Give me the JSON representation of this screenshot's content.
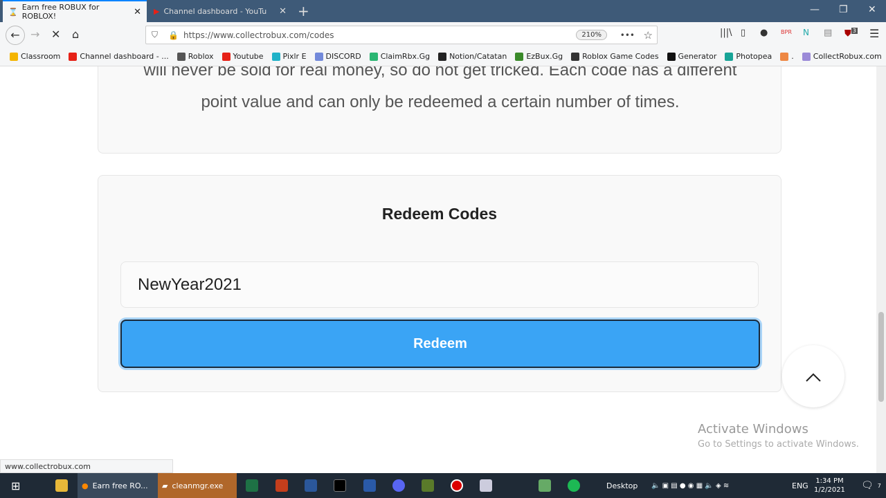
{
  "browser": {
    "tabs": [
      {
        "label": "Earn free ROBUX for ROBLOX!",
        "icon": "hourglass-icon",
        "active": true
      },
      {
        "label": "Channel dashboard - YouTube",
        "icon": "youtube-icon",
        "active": false
      }
    ],
    "url": "https://www.collectrobux.com/codes",
    "zoom": "210%",
    "bookmarks": [
      {
        "label": "Classroom",
        "color": "#f4b400"
      },
      {
        "label": "Channel dashboard - ...",
        "color": "#e62117"
      },
      {
        "label": "Roblox",
        "color": "#555"
      },
      {
        "label": "Youtube",
        "color": "#e62117"
      },
      {
        "label": "Pixlr E",
        "color": "#20b2c8"
      },
      {
        "label": "DISCORD",
        "color": "#7289da"
      },
      {
        "label": "ClaimRbx.Gg",
        "color": "#2bb673"
      },
      {
        "label": "Notion/Catatan",
        "color": "#222"
      },
      {
        "label": "EzBux.Gg",
        "color": "#3a8a2a"
      },
      {
        "label": "Roblox Game Codes",
        "color": "#333"
      },
      {
        "label": "Generator",
        "color": "#111"
      },
      {
        "label": "Photopea",
        "color": "#18a497"
      },
      {
        "label": ".",
        "color": "#e84"
      },
      {
        "label": "CollectRobux.com",
        "color": "#9b8ad8"
      }
    ],
    "status_url": "www.collectrobux.com",
    "extension_badge": "3"
  },
  "page": {
    "description": "will never be sold for real money, so do not get tricked. Each code has a different point value and can only be redeemed a certain number of times.",
    "redeem_title": "Redeem Codes",
    "code_value": "NewYear2021",
    "redeem_button": "Redeem",
    "accent": "#3aa4f5"
  },
  "watermark": {
    "title": "Activate Windows",
    "subtitle": "Go to Settings to activate Windows."
  },
  "taskbar": {
    "apps": [
      {
        "label": "Earn free RO..."
      },
      {
        "label": "cleanmgr.exe"
      }
    ],
    "desktop_label": "Desktop",
    "language": "ENG",
    "time": "1:34 PM",
    "date": "1/2/2021",
    "notification_count": "7"
  }
}
